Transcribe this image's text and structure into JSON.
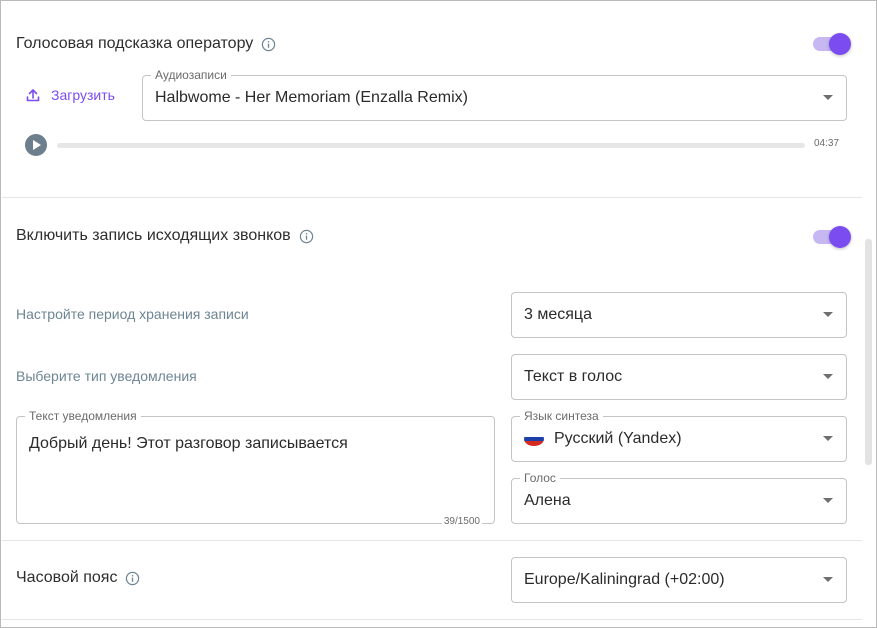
{
  "voice_hint": {
    "title": "Голосовая подсказка оператору",
    "upload_label": "Загрузить",
    "audio_field": {
      "legend": "Аудиозаписи",
      "value": "Halbwome - Her Memoriam (Enzalla Remix)"
    },
    "player": {
      "duration": "04:37"
    }
  },
  "record_outgoing": {
    "title": "Включить запись исходящих звонков",
    "storage_label": "Настройте период хранения записи",
    "storage_value": "3 месяца",
    "notify_type_label": "Выберите тип уведомления",
    "notify_type_value": "Текст в голос",
    "notify_text": {
      "legend": "Текст уведомления",
      "value": "Добрый день! Этот разговор записывается",
      "counter": "39/1500"
    },
    "synth_language": {
      "legend": "Язык синтеза",
      "value": "Русский (Yandex)"
    },
    "voice": {
      "legend": "Голос",
      "value": "Алена"
    }
  },
  "timezone": {
    "title": "Часовой пояс",
    "value": "Europe/Kaliningrad (+02:00)"
  },
  "colors": {
    "accent": "#7b4cf0",
    "toggle_track": "#c7b8f4",
    "muted_label": "#6e8594"
  }
}
